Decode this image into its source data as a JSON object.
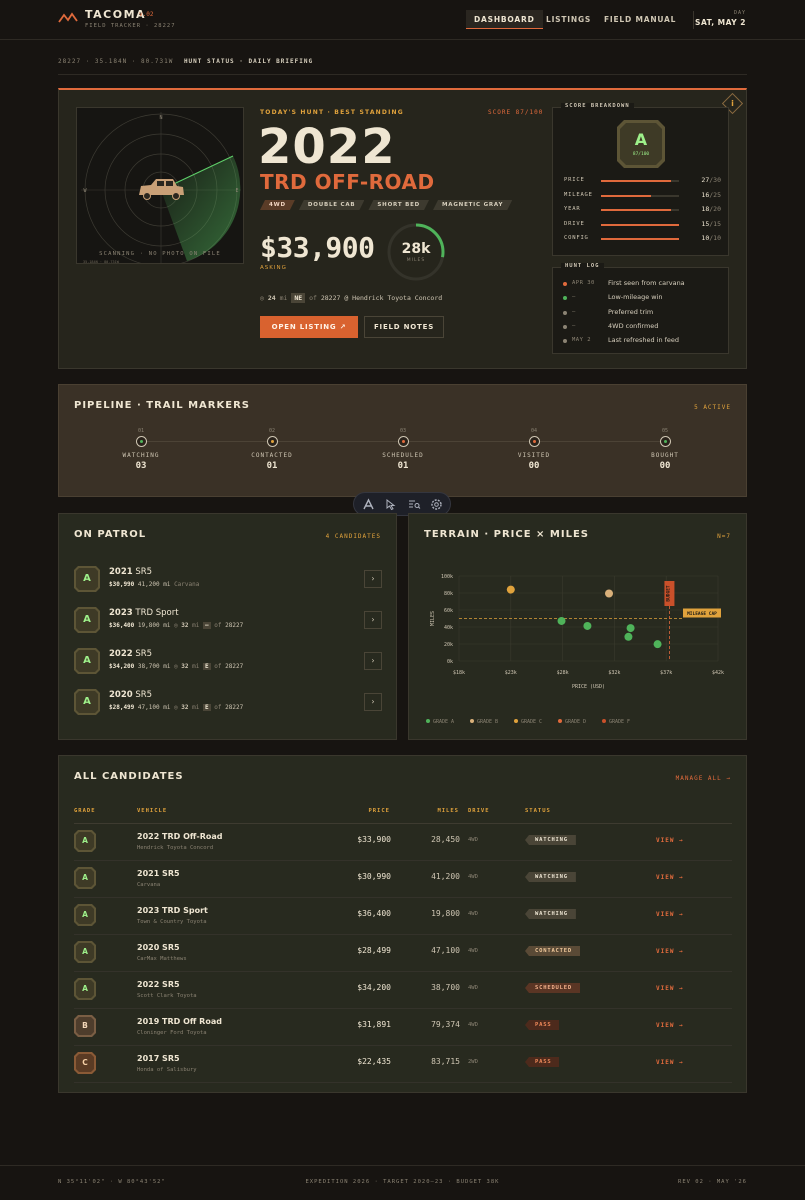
{
  "brand": {
    "name": "TACOMA",
    "version": "v.02",
    "subtitle": "FIELD TRACKER · 28227"
  },
  "nav": {
    "tabs": [
      "DASHBOARD",
      "LISTINGS",
      "FIELD MANUAL"
    ],
    "active": "DASHBOARD"
  },
  "date": {
    "label": "DAY",
    "value": "SAT, MAY 2"
  },
  "status_bar": {
    "coords": "28227 · 35.184N · 80.731W",
    "title": "HUNT STATUS · DAILY BRIEFING"
  },
  "hero": {
    "kicker": "TODAY'S HUNT · BEST STANDING",
    "score": "SCORE 87/100",
    "year": "2022",
    "trim": "TRD OFF-ROAD",
    "chips": [
      "4WD",
      "DOUBLE CAB",
      "SHORT BED",
      "MAGNETIC GRAY"
    ],
    "price": "$33,900",
    "asking_label": "ASKING",
    "miles_value": "28k",
    "miles_unit": "MILES",
    "miles_gauge_fraction": 0.28,
    "distance": "24",
    "distance_unit": "mi",
    "direction": "NE",
    "of_label": "of",
    "zip": "28227",
    "dealer": "@ Hendrick Toyota Concord",
    "open_label": "OPEN LISTING ↗",
    "notes_label": "FIELD NOTES",
    "radar_caption": "SCANNING · NO PHOTO ON FILE",
    "radar_coords": "35.184N · 80.731W",
    "radar_marks": [
      "N",
      "E",
      "S",
      "W"
    ]
  },
  "score_breakdown": {
    "title": "SCORE BREAKDOWN",
    "grade": "A",
    "grade_score": "87/100",
    "rows": [
      {
        "label": "PRICE",
        "value": "27",
        "max": "/30"
      },
      {
        "label": "MILEAGE",
        "value": "16",
        "max": "/25"
      },
      {
        "label": "YEAR",
        "value": "18",
        "max": "/20"
      },
      {
        "label": "DRIVE",
        "value": "15",
        "max": "/15"
      },
      {
        "label": "CONFIG",
        "value": "10",
        "max": "/10"
      }
    ]
  },
  "hunt_log": {
    "title": "HUNT LOG",
    "entries": [
      {
        "date": "APR 30",
        "text": "First seen from carvana",
        "color": "#e06a3c"
      },
      {
        "date": "—",
        "text": "Low-mileage win",
        "color": "#4fb35a"
      },
      {
        "date": "—",
        "text": "Preferred trim",
        "color": "#8b8373"
      },
      {
        "date": "—",
        "text": "4WD confirmed",
        "color": "#8b8373"
      },
      {
        "date": "MAY 2",
        "text": "Last refreshed in feed",
        "color": "#8b8373"
      }
    ]
  },
  "pipeline": {
    "title": "PIPELINE · TRAIL MARKERS",
    "active": "5 ACTIVE",
    "stages": [
      {
        "num": "01",
        "label": "WATCHING",
        "count": "03",
        "color": "#4fb35a"
      },
      {
        "num": "02",
        "label": "CONTACTED",
        "count": "01",
        "color": "#e0a23c"
      },
      {
        "num": "03",
        "label": "SCHEDULED",
        "count": "01",
        "color": "#e06a3c"
      },
      {
        "num": "04",
        "label": "VISITED",
        "count": "00",
        "color": "#e06a3c"
      },
      {
        "num": "05",
        "label": "BOUGHT",
        "count": "00",
        "color": "#4fb35a"
      }
    ]
  },
  "toolbar": {
    "icons": [
      "logo-icon",
      "cursor-icon",
      "search-list-icon",
      "gear-icon"
    ]
  },
  "patrol": {
    "title": "ON PATROL",
    "count": "4 CANDIDATES",
    "items": [
      {
        "grade": "A",
        "year": "2021",
        "model": "SR5",
        "price": "$30,990",
        "miles": "41,200 mi",
        "source": "Carvana"
      },
      {
        "grade": "A",
        "year": "2023",
        "model": "TRD Sport",
        "price": "$36,400",
        "miles": "19,800 mi",
        "dist": "32",
        "dir": "—",
        "zip": "28227"
      },
      {
        "grade": "A",
        "year": "2022",
        "model": "SR5",
        "price": "$34,200",
        "miles": "38,700 mi",
        "dist": "32",
        "dir": "E",
        "zip": "28227"
      },
      {
        "grade": "A",
        "year": "2020",
        "model": "SR5",
        "price": "$28,499",
        "miles": "47,100 mi",
        "dist": "32",
        "dir": "E",
        "zip": "28227"
      }
    ],
    "dist_unit": "mi",
    "of_label": "of"
  },
  "chart_data": {
    "type": "scatter",
    "title": "TERRAIN · PRICE × MILES",
    "count": "N=7",
    "xlabel": "PRICE (USD)",
    "ylabel": "MILES",
    "xlim": [
      18000,
      42000
    ],
    "ylim": [
      0,
      100000
    ],
    "x_ticks": [
      "$18k",
      "$23k",
      "$28k",
      "$32k",
      "$37k",
      "$42k"
    ],
    "y_ticks": [
      "0k",
      "20k",
      "40k",
      "60k",
      "80k",
      "100k"
    ],
    "mileage_cap": 50000,
    "mileage_cap_label": "MILEAGE CAP",
    "budget_line": 37500,
    "budget_label": "BUDGET",
    "points": [
      {
        "x": 22800,
        "y": 84000,
        "grade": "C",
        "color": "#e0a23c"
      },
      {
        "x": 27500,
        "y": 47100,
        "grade": "A",
        "color": "#4fb35a"
      },
      {
        "x": 29900,
        "y": 41200,
        "grade": "A",
        "color": "#4fb35a"
      },
      {
        "x": 31900,
        "y": 79400,
        "grade": "B",
        "color": "#d9b07a"
      },
      {
        "x": 33900,
        "y": 38700,
        "grade": "A",
        "color": "#4fb35a"
      },
      {
        "x": 33700,
        "y": 28500,
        "grade": "A",
        "color": "#4fb35a"
      },
      {
        "x": 36400,
        "y": 19800,
        "grade": "A",
        "color": "#4fb35a"
      }
    ],
    "legend": [
      {
        "label": "GRADE A",
        "color": "#4fb35a"
      },
      {
        "label": "GRADE B",
        "color": "#d9b07a"
      },
      {
        "label": "GRADE C",
        "color": "#e0a23c"
      },
      {
        "label": "GRADE D",
        "color": "#e06a3c"
      },
      {
        "label": "GRADE F",
        "color": "#c9502a"
      }
    ]
  },
  "all_candidates": {
    "title": "ALL CANDIDATES",
    "manage": "MANAGE ALL →",
    "headers": {
      "grade": "GRADE",
      "vehicle": "VEHICLE",
      "price": "PRICE",
      "miles": "MILES",
      "drive": "DRIVE",
      "status": "STATUS"
    },
    "rows": [
      {
        "grade": "A",
        "vehicle": "2022 TRD Off-Road",
        "dealer": "Hendrick Toyota Concord",
        "price": "$33,900",
        "miles": "28,450",
        "drive": "4WD",
        "status": "WATCHING",
        "status_kind": "watching",
        "view": "VIEW →"
      },
      {
        "grade": "A",
        "vehicle": "2021 SR5",
        "dealer": "Carvana",
        "price": "$30,990",
        "miles": "41,200",
        "drive": "4WD",
        "status": "WATCHING",
        "status_kind": "watching",
        "view": "VIEW →"
      },
      {
        "grade": "A",
        "vehicle": "2023 TRD Sport",
        "dealer": "Town & Country Toyota",
        "price": "$36,400",
        "miles": "19,800",
        "drive": "4WD",
        "status": "WATCHING",
        "status_kind": "watching",
        "view": "VIEW →"
      },
      {
        "grade": "A",
        "vehicle": "2020 SR5",
        "dealer": "CarMax Matthews",
        "price": "$28,499",
        "miles": "47,100",
        "drive": "4WD",
        "status": "CONTACTED",
        "status_kind": "contacted",
        "view": "VIEW →"
      },
      {
        "grade": "A",
        "vehicle": "2022 SR5",
        "dealer": "Scott Clark Toyota",
        "price": "$34,200",
        "miles": "38,700",
        "drive": "4WD",
        "status": "SCHEDULED",
        "status_kind": "scheduled",
        "view": "VIEW →"
      },
      {
        "grade": "B",
        "vehicle": "2019 TRD Off Road",
        "dealer": "Cloninger Ford Toyota",
        "price": "$31,891",
        "miles": "79,374",
        "drive": "4WD",
        "status": "PASS",
        "status_kind": "pass",
        "view": "VIEW →"
      },
      {
        "grade": "C",
        "vehicle": "2017 SR5",
        "dealer": "Honda of Salisbury",
        "price": "$22,435",
        "miles": "83,715",
        "drive": "2WD",
        "status": "PASS",
        "status_kind": "pass",
        "view": "VIEW →"
      }
    ]
  },
  "footer": {
    "left": "N 35°11'02\" · W 80°43'52\"",
    "center": "EXPEDITION 2026 · TARGET 2020–23 · BUDGET 38K",
    "right": "REV 02 · MAY '26"
  },
  "colors": {
    "accent": "#e06a3c",
    "gold": "#e0a23c",
    "green": "#4fb35a",
    "bg": "#171411"
  }
}
